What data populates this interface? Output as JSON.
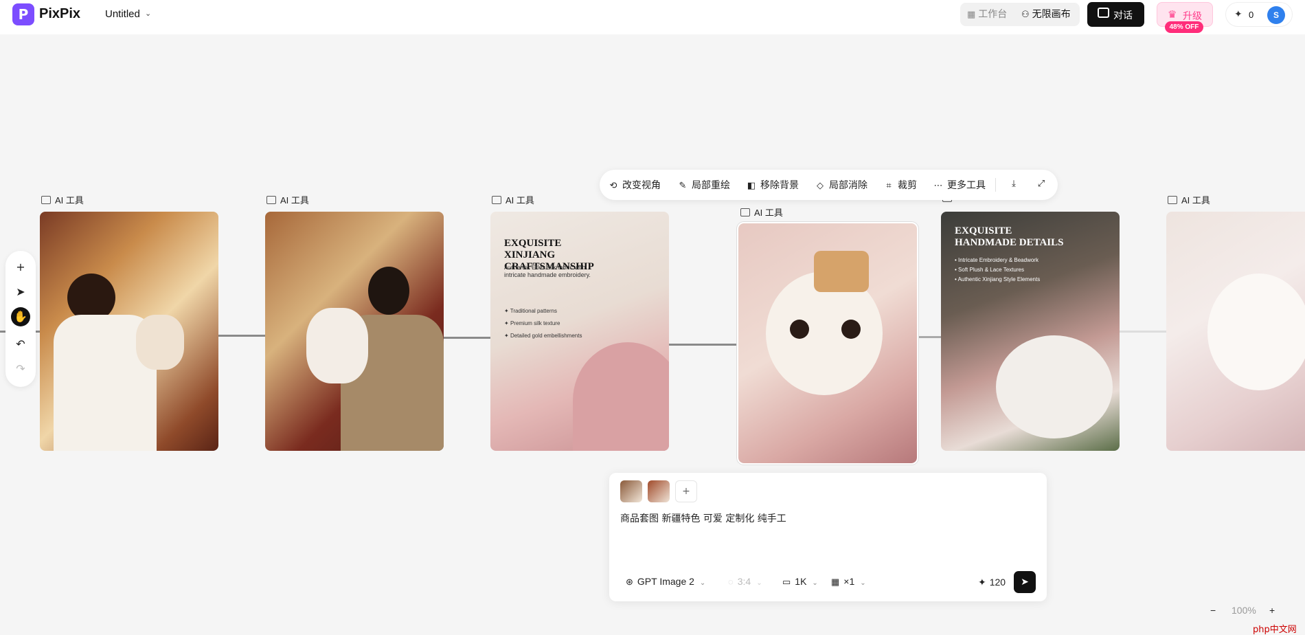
{
  "app": {
    "logo_letter": "P",
    "name": "PixPix",
    "doc_title": "Untitled"
  },
  "header": {
    "workspace_label": "工作台",
    "canvas_label": "无限画布",
    "chat_label": "对话",
    "upgrade_label": "升级",
    "discount_badge": "48% OFF",
    "credits": "0",
    "avatar_initial": "S"
  },
  "cards": [
    {
      "label": "AI 工具"
    },
    {
      "label": "AI 工具"
    },
    {
      "label": "AI 工具",
      "overlay_title": "EXQUISITE XINJIANG CRAFTSMANSHIP",
      "overlay_sub": "Authentic Etles silk fabric with intricate handmade embroidery.",
      "overlay_list": [
        "Traditional patterns",
        "Premium silk texture",
        "Detailed gold embellishments"
      ]
    },
    {
      "label": "AI 工具"
    },
    {
      "overlay_title": "EXQUISITE HANDMADE DETAILS",
      "overlay_list": [
        "Intricate Embroidery & Beadwork",
        "Soft Plush & Lace Textures",
        "Authentic Xinjiang Style Elements"
      ]
    },
    {
      "label": "AI 工具"
    }
  ],
  "toolbar": {
    "change_view": "改变视角",
    "inpaint": "局部重绘",
    "remove_bg": "移除背景",
    "erase": "局部消除",
    "crop": "裁剪",
    "more_tools": "更多工具"
  },
  "prompt": {
    "text": "商品套图 新疆特色 可爱 定制化 纯手工",
    "model": "GPT Image 2",
    "ratio": "3:4",
    "resolution": "1K",
    "count": "×1",
    "cost": "120"
  },
  "zoom": {
    "value": "100%"
  },
  "watermark": "php中文网",
  "icons": [
    "workspace-grid-icon",
    "canvas-nodes-icon",
    "chat-bubble-icon",
    "crown-icon",
    "sparkle-icon",
    "image-icon",
    "plus-icon",
    "pointer-icon",
    "hand-icon",
    "undo-icon",
    "redo-icon",
    "send-icon",
    "download-icon",
    "expand-icon"
  ],
  "colors": {
    "accent_purple": "#7c4dff",
    "upgrade_pink": "#ff3d8b",
    "badge_pink": "#ff2d7a",
    "avatar_blue": "#2f80ed",
    "dark_button": "#111111"
  }
}
